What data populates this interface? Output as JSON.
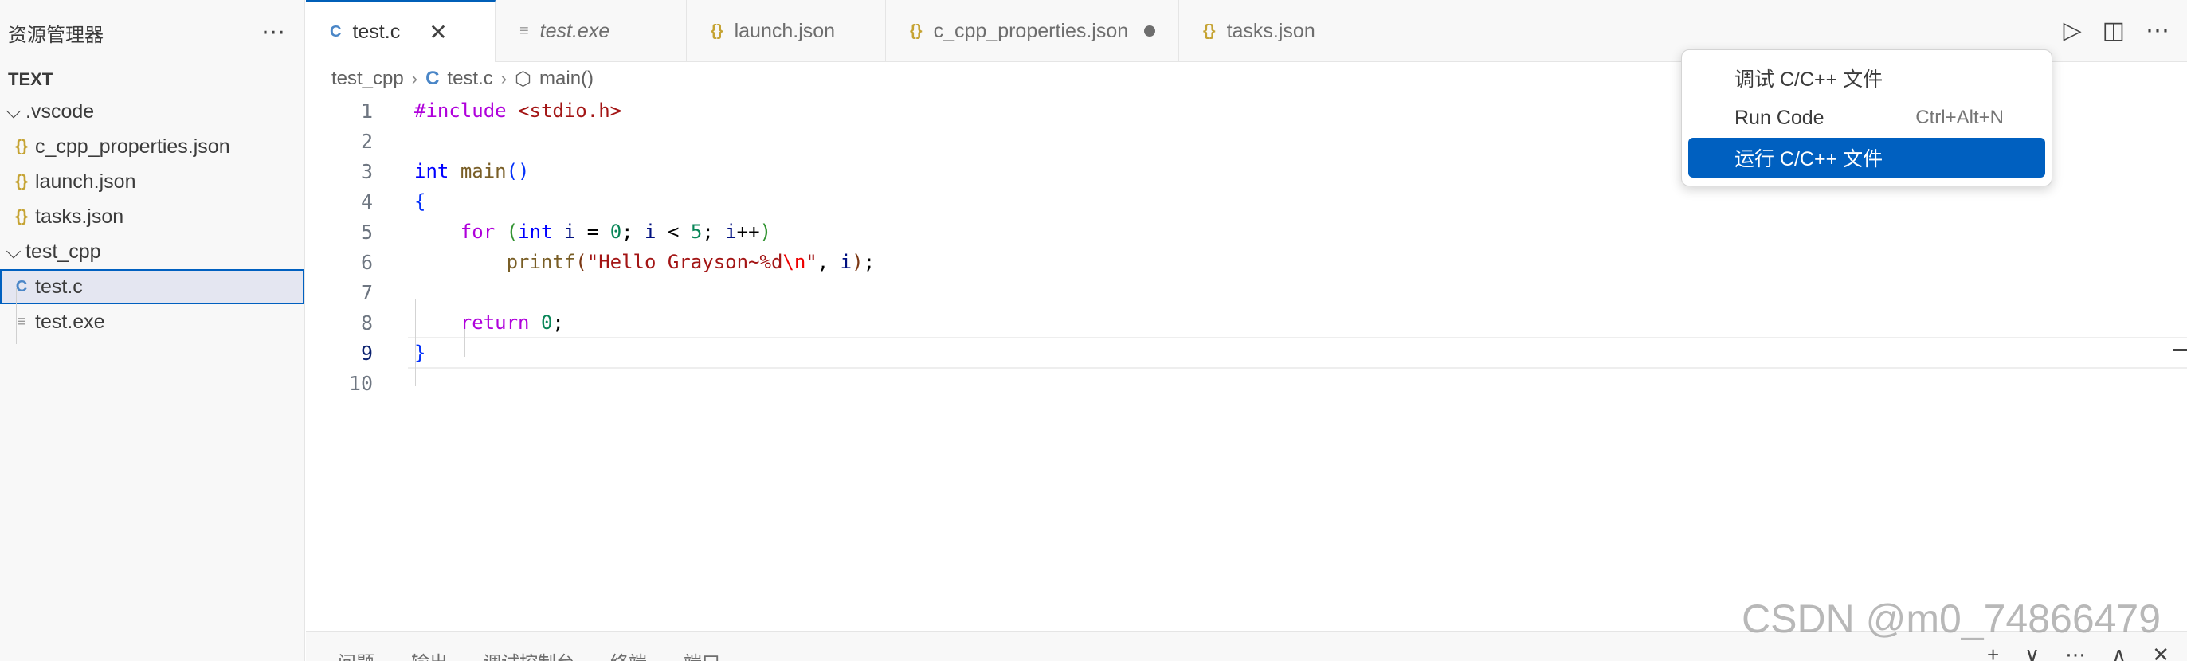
{
  "sidebar": {
    "title": "资源管理器",
    "more_icon": "ellipsis-icon",
    "section": "TEXT",
    "tree": [
      {
        "label": ".vscode",
        "type": "folder",
        "expanded": true
      },
      {
        "label": "c_cpp_properties.json",
        "type": "json",
        "icon": "{}"
      },
      {
        "label": "launch.json",
        "type": "json",
        "icon": "{}"
      },
      {
        "label": "tasks.json",
        "type": "json",
        "icon": "{}"
      },
      {
        "label": "test_cpp",
        "type": "folder",
        "expanded": true
      },
      {
        "label": "test.c",
        "type": "c",
        "icon": "C",
        "selected": true
      },
      {
        "label": "test.exe",
        "type": "exe",
        "icon": "≡"
      }
    ]
  },
  "tabs": [
    {
      "label": "test.c",
      "icon": "C",
      "active": true,
      "close": "✕"
    },
    {
      "label": "test.exe",
      "icon": "≡",
      "italic": true
    },
    {
      "label": "launch.json",
      "icon": "{}"
    },
    {
      "label": "c_cpp_properties.json",
      "icon": "{}",
      "modified": true
    },
    {
      "label": "tasks.json",
      "icon": "{}"
    }
  ],
  "tab_actions": {
    "run": "▷",
    "split": "◫",
    "more": "⋯"
  },
  "breadcrumb": {
    "folder": "test_cpp",
    "file_icon": "C",
    "file": "test.c",
    "symbol_icon": "⬡",
    "symbol": "main()",
    "separator": "›"
  },
  "editor": {
    "current_line": 9,
    "line_numbers": [
      "1",
      "2",
      "3",
      "4",
      "5",
      "6",
      "7",
      "8",
      "9",
      "10"
    ],
    "code": {
      "l1_directive": "#include",
      "l1_header": " <stdio.h>",
      "l3_type": "int",
      "l3_fn": "main",
      "l3_parens": "()",
      "l4_brace": "{",
      "l5_for": "for",
      "l5_open": "(",
      "l5_int": "int",
      "l5_i1": "i",
      "l5_eq": " = ",
      "l5_zero": "0",
      "l5_semi1": "; ",
      "l5_i2": "i",
      "l5_lt": " < ",
      "l5_five": "5",
      "l5_semi2": "; ",
      "l5_i3": "i",
      "l5_pp": "++",
      "l5_close": ")",
      "l6_fn": "printf",
      "l6_open": "(",
      "l6_str": "\"Hello Grayson~%d",
      "l6_esc": "\\n",
      "l6_strend": "\"",
      "l6_comma": ", ",
      "l6_i": "i",
      "l6_close": ")",
      "l6_semi": ";",
      "l8_return": "return",
      "l8_zero": "0",
      "l8_semi": ";",
      "l9_brace": "}"
    }
  },
  "dropdown": {
    "items": [
      {
        "label": "调试 C/C++ 文件",
        "shortcut": ""
      },
      {
        "label": "Run Code",
        "shortcut": "Ctrl+Alt+N"
      },
      {
        "label": "运行 C/C++ 文件",
        "shortcut": "",
        "highlighted": true
      }
    ]
  },
  "panel": {
    "tabs": [
      "问题",
      "输出",
      "调试控制台",
      "终端",
      "端口"
    ],
    "actions": [
      "+",
      "∨",
      "⋯",
      "∧",
      "✕"
    ]
  },
  "watermark": "CSDN @m0_74866479",
  "colors": {
    "accent": "#005fb8",
    "highlight": "#0060c0",
    "keyword": "#0000ff",
    "string": "#a31515",
    "number": "#098658"
  }
}
